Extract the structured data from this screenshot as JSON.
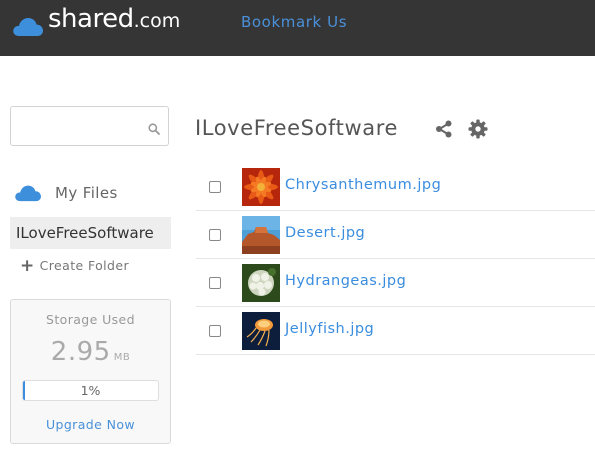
{
  "header": {
    "logo_main": "shared",
    "logo_domain": ".com",
    "bookmark_label": "Bookmark Us"
  },
  "sidebar": {
    "search_placeholder": "",
    "search_icon": "search-icon",
    "my_files_label": "My Files",
    "folders": [
      "ILoveFreeSoftware"
    ],
    "create_folder_label": "Create Folder",
    "storage": {
      "title": "Storage Used",
      "amount": "2.95",
      "unit": "MB",
      "percent_label": "1%",
      "percent_value": 1,
      "upgrade_label": "Upgrade Now"
    }
  },
  "main": {
    "folder_title": "ILoveFreeSoftware",
    "icons": [
      "share-icon",
      "gear-icon"
    ],
    "files": [
      {
        "name": "Chrysanthemum.jpg",
        "thumb": "chrysanthemum-thumbnail"
      },
      {
        "name": "Desert.jpg",
        "thumb": "desert-thumbnail"
      },
      {
        "name": "Hydrangeas.jpg",
        "thumb": "hydrangeas-thumbnail"
      },
      {
        "name": "Jellyfish.jpg",
        "thumb": "jellyfish-thumbnail"
      }
    ]
  },
  "colors": {
    "topbar": "#353535",
    "accent": "#3a8ddf",
    "logo_cloud": "#3d8fdc"
  }
}
